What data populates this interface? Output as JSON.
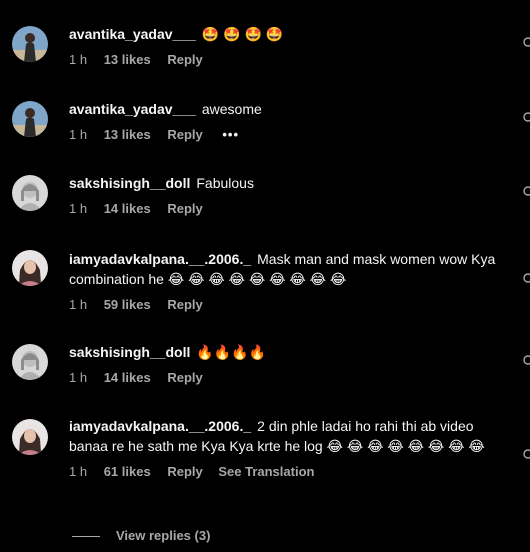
{
  "comments": [
    {
      "username": "avantika_yadav___",
      "text": "🤩 🤩 🤩 🤩",
      "time": "1 h",
      "likes": "13 likes",
      "reply": "Reply",
      "more": "",
      "translate": ""
    },
    {
      "username": "avantika_yadav___",
      "text": "awesome",
      "time": "1 h",
      "likes": "13 likes",
      "reply": "Reply",
      "more": "•••",
      "translate": ""
    },
    {
      "username": "sakshisingh__doll",
      "text": "Fabulous",
      "time": "1 h",
      "likes": "14 likes",
      "reply": "Reply",
      "more": "",
      "translate": ""
    },
    {
      "username": "iamyadavkalpana.__.2006._",
      "text": "Mask man and mask women wow Kya combination he 😂 😂 😂 😂 😂 😂 😂 😂 😂",
      "time": "1 h",
      "likes": "59 likes",
      "reply": "Reply",
      "more": "",
      "translate": ""
    },
    {
      "username": "sakshisingh__doll",
      "text": "🔥🔥🔥🔥",
      "time": "1 h",
      "likes": "14 likes",
      "reply": "Reply",
      "more": "",
      "translate": ""
    },
    {
      "username": "iamyadavkalpana.__.2006._",
      "text": "2 din phle ladai ho rahi thi ab video banaa re he sath me Kya Kya krte he log 😂 😂 😂 😂 😂 😂 😂 😂",
      "time": "1 h",
      "likes": "61 likes",
      "reply": "Reply",
      "more": "",
      "translate": "See Translation"
    }
  ],
  "view_replies": "View replies (3)",
  "icons": {
    "like": "heart-icon",
    "more": "more-options-icon"
  }
}
